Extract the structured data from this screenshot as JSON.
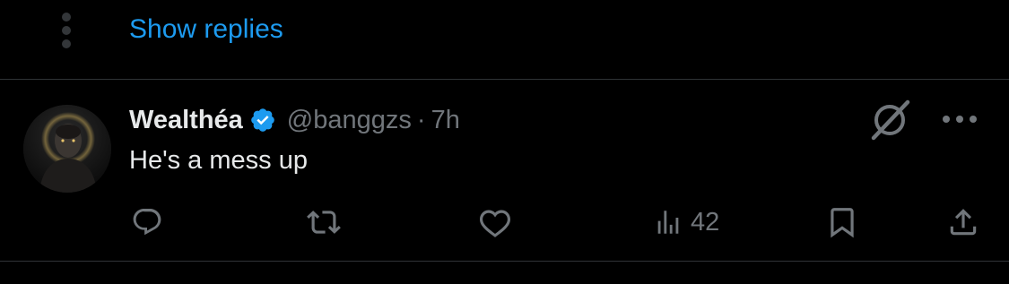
{
  "thread": {
    "show_replies_label": "Show replies"
  },
  "tweet": {
    "display_name": "Wealthéa",
    "verified": true,
    "handle": "@banggzs",
    "separator": "·",
    "time": "7h",
    "text": "He's a mess up",
    "avatar_icon": "person-portrait-avatar",
    "header_icons": [
      "grok-icon",
      "more-icon"
    ]
  },
  "actions": {
    "reply_icon": "reply-icon",
    "retweet_icon": "retweet-icon",
    "like_icon": "heart-icon",
    "views_icon": "views-icon",
    "views_count": "42",
    "bookmark_icon": "bookmark-icon",
    "share_icon": "share-icon"
  },
  "colors": {
    "background": "#000000",
    "primary_text": "#e7e9ea",
    "secondary_text": "#71767b",
    "link": "#1d9bf0",
    "verified_badge": "#1d9bf0",
    "divider": "#2f3336"
  }
}
